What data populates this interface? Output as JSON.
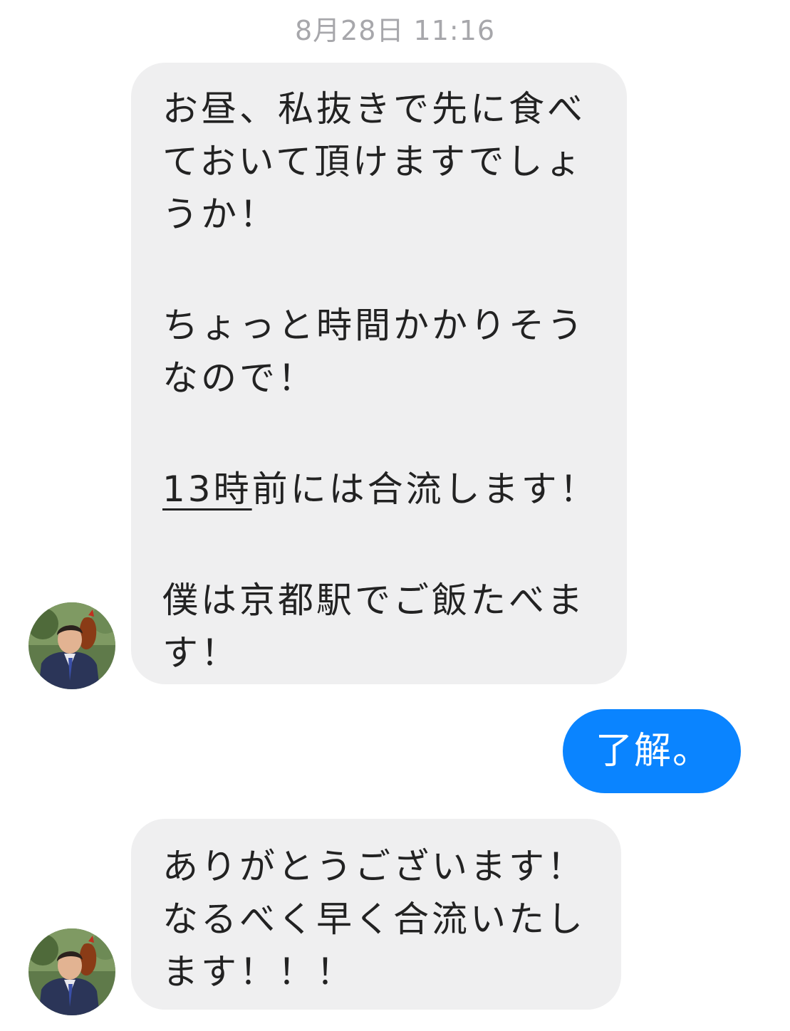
{
  "header": {
    "timestamp": "8月28日 11:16"
  },
  "messages": [
    {
      "from": "other",
      "lines": [
        "お昼、私抜きで先に食べ",
        "ておいて頂けますでしょ",
        "うか！",
        "",
        "ちょっと時間かかりそう",
        "なので！",
        "",
        "13時前には合流します！",
        "",
        "僕は京都駅でご飯たべま",
        "す！"
      ],
      "underlined_part": "13時",
      "line8_rest": "前には合流します！"
    },
    {
      "from": "me",
      "text": "了解。"
    },
    {
      "from": "other",
      "lines": [
        "ありがとうございます！",
        "なるべく早く合流いたし",
        "ます！！！"
      ]
    }
  ],
  "colors": {
    "incoming_bubble": "#efeff0",
    "outgoing_bubble": "#0a84ff",
    "timestamp": "#a7a7ab"
  },
  "icons": {
    "avatar": "contact-avatar-photo"
  }
}
